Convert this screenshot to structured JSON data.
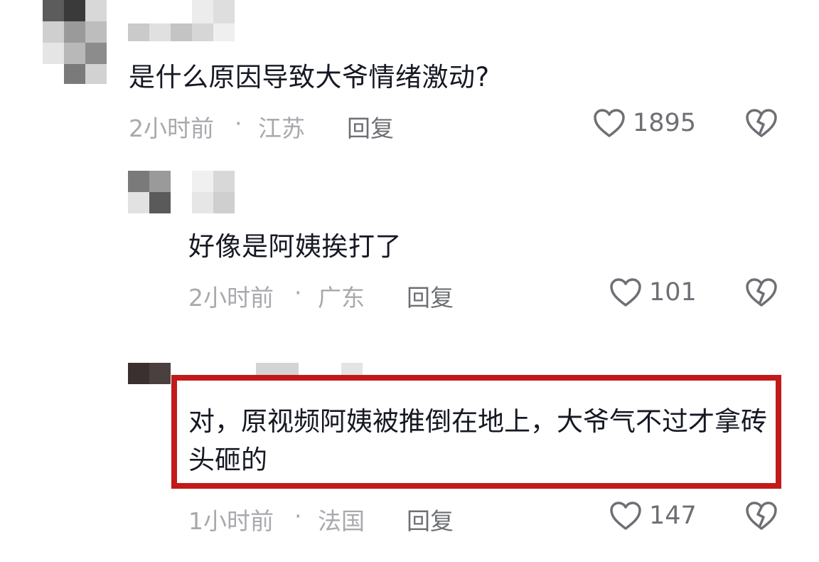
{
  "comments": [
    {
      "text": "是什么原因导致大爷情绪激动?",
      "time": "2小时前",
      "location": "江苏",
      "reply_label": "回复",
      "likes": "1895"
    },
    {
      "text": "好像是阿姨挨打了",
      "time": "2小时前",
      "location": "广东",
      "reply_label": "回复",
      "likes": "101"
    },
    {
      "text": "对，原视频阿姨被推倒在地上，大爷气不过才拿砖头砸的",
      "time": "1小时前",
      "location": "法国",
      "reply_label": "回复",
      "likes": "147",
      "highlight_color": "#c21a1a"
    }
  ],
  "separator": "·",
  "icons": {
    "like": "heart-outline-icon",
    "dislike": "broken-heart-icon"
  }
}
